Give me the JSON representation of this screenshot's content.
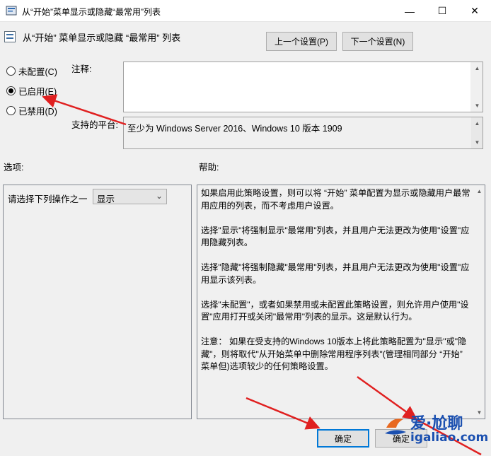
{
  "window": {
    "title": "从“开始”菜单显示或隐藏“最常用”列表",
    "minimize_glyph": "—",
    "maximize_glyph": "☐",
    "close_glyph": "✕"
  },
  "header": {
    "policy_title": "从“开始” 菜单显示或隐藏 “最常用” 列表",
    "prev_button": "上一个设置(P)",
    "next_button": "下一个设置(N)"
  },
  "state": {
    "options": [
      {
        "label": "未配置(C)",
        "checked": false
      },
      {
        "label": "已启用(E)",
        "checked": true
      },
      {
        "label": "已禁用(D)",
        "checked": false
      }
    ]
  },
  "comment": {
    "label": "注释:",
    "value": ""
  },
  "platform": {
    "label": "支持的平台:",
    "value": "至少为 Windows Server 2016、Windows 10 版本 1909"
  },
  "options_section": {
    "label": "选项:",
    "select_label": "请选择下列操作之一",
    "select_value": "显示"
  },
  "help_section": {
    "label": "帮助:",
    "paragraphs": [
      "如果启用此策略设置，则可以将 “开始” 菜单配置为显示或隐藏用户最常用应用的列表，而不考虑用户设置。",
      "选择\"显示\"将强制显示\"最常用\"列表，并且用户无法更改为使用\"设置\"应用隐藏列表。",
      "选择\"隐藏\"将强制隐藏\"最常用\"列表，并且用户无法更改为使用\"设置\"应用显示该列表。",
      "选择\"未配置\"，或者如果禁用或未配置此策略设置，则允许用户使用\"设置\"应用打开或关闭\"最常用\"列表的显示。这是默认行为。",
      "注意： 如果在受支持的Windows 10版本上将此策略配置为\"显示\"或\"隐藏\"，则将取代\"从开始菜单中删除常用程序列表\"(管理相同部分 “开始” 菜单但)选项较少的任何策略设置。"
    ]
  },
  "footer": {
    "ok_button": "确定",
    "cancel_button": "确定"
  },
  "watermark": {
    "brand": "爱·尬聊",
    "url": "igaliao.com"
  },
  "colors": {
    "annotation_arrow": "#e02020",
    "watermark_blue": "#1a4fb0"
  }
}
